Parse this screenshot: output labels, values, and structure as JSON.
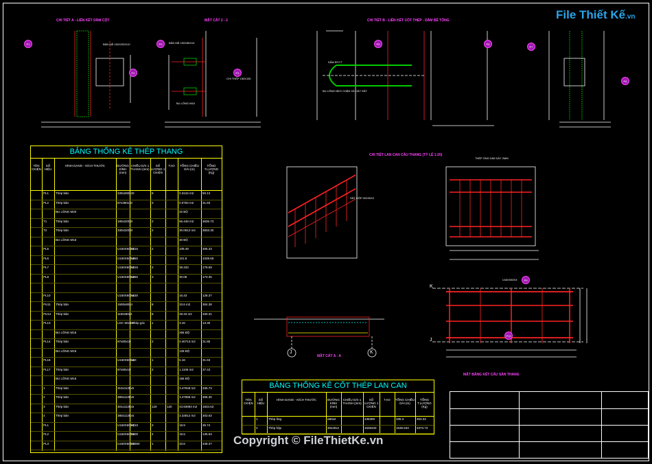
{
  "logo": {
    "brand": "File Thiết Kế",
    "domain": ".vn"
  },
  "copyright": "Copyright © FileThietKe.vn",
  "detail_titles": {
    "d1": "CHI TIẾT A - LIÊN KẾT DẦM CỘT",
    "d2": "MẶT CẮT 2 - 2",
    "d3": "CHI TIẾT B - LIÊN KẾT CỐT THÉP - DẦM BÊ TÔNG",
    "d5": "CHI TIẾT LAN CAN CẦU THANG (TỶ LỆ 1:20)",
    "d7": "MẶT CẮT A - A",
    "d8": "MẶT BẰNG KẾT CẤU SÀN THANG"
  },
  "annotations": {
    "a1": "BẢN MÃ 150X200X10",
    "a2": "BẢN MÃ 150X80X10",
    "a3": "BU LÔNG M16",
    "a4": "CHI THÉP 150X150",
    "a5": "DẦM BTCT",
    "a6": "BU LÔNG NEO CHẬN VÀ DÁY SẮT",
    "a7": "THÉP ỐNG D60 DÀY 2MM",
    "a8": "SẮT HỘP 30X30X2",
    "a9": "U160X60X4"
  },
  "tags": [
    "P1",
    "P2",
    "P3",
    "P4",
    "P5",
    "P6",
    "P7",
    "P8",
    "P9",
    "P10"
  ],
  "axis_marks": [
    "K",
    "J",
    "J",
    "K"
  ],
  "table1": {
    "title": "BẢNG THỐNG KÊ THÉP THANG",
    "headers": [
      "TÊN CKIỆN",
      "SỐ HIỆU",
      "HÌNH DẠNG - KÍCH THƯỚC",
      "ĐƯỜNG KÍNH (mm)",
      "CHIỀU DÀI 1 THANH (mm)",
      "SỐ LƯỢNG 1 CKIỆN",
      "TẠO",
      "TỔNG CHIỀU DÀI (m)",
      "TỔNG T.LƯỢNG (Kg)"
    ],
    "rows": [
      [
        "",
        "PL1",
        "Thép bản",
        "330x280x20",
        "",
        "8",
        "",
        "0.3134 m2",
        "50.13"
      ],
      [
        "",
        "PL2",
        "Thép bản",
        "87x380x10",
        "",
        "3",
        "",
        "0.0784 m2",
        "31.83"
      ],
      [
        "",
        "",
        "BU LÔNG M20",
        "",
        "",
        "",
        "",
        "32 BỘ",
        ""
      ],
      [
        "",
        "T1",
        "Thép bản",
        "180x320x8",
        "",
        "2",
        "",
        "56.448 m2",
        "3635.73"
      ],
      [
        "",
        "T2",
        "Thép bản",
        "330x320x8",
        "",
        "2",
        "",
        "30.0912 m2",
        "3833.30"
      ],
      [
        "",
        "",
        "BU LÔNG M16",
        "",
        "",
        "",
        "",
        "30 BỘ",
        ""
      ],
      [
        "",
        "PL5",
        "",
        "U160X60X4",
        "3315",
        "2",
        "",
        "109.49",
        "305.33"
      ],
      [
        "",
        "PL6",
        "",
        "U160X60X4",
        "1860",
        "",
        "",
        "101.8",
        "1039.59"
      ],
      [
        "",
        "PL7",
        "",
        "U160X60X4",
        "1315",
        "3",
        "",
        "38.333",
        "179.59"
      ],
      [
        "",
        "PL8",
        "",
        "U160X60X4",
        "1360",
        "3",
        "",
        "30.08",
        "173.35"
      ],
      [
        "",
        "",
        "",
        "",
        "",
        "",
        "",
        "",
        ""
      ],
      [
        "",
        "PL10",
        "",
        "U160X60X4",
        "1630",
        "",
        "",
        "16.43",
        "128.37"
      ],
      [
        "",
        "PU11",
        "Thép bản",
        "1500x80x4",
        "",
        "8",
        "",
        "33.6 m2",
        "304.38"
      ],
      [
        "",
        "PU12",
        "Thép bản",
        "1150x80x4",
        "",
        "8",
        "",
        "28.33 m2",
        "330.31"
      ],
      [
        "",
        "PL13",
        "",
        "LGC 50x5 Thép góc",
        "50",
        "1",
        "",
        "3.15",
        "13.30"
      ],
      [
        "",
        "",
        "BU LÔNG M16",
        "",
        "",
        "",
        "",
        "256 BỘ",
        ""
      ],
      [
        "",
        "PL14",
        "Thép bản",
        "87x80x10",
        "",
        "2",
        "",
        "0.40713 m2",
        "31.85"
      ],
      [
        "",
        "",
        "BU LÔNG M16",
        "",
        "",
        "",
        "",
        "128 BỘ",
        ""
      ],
      [
        "",
        "PL16",
        "",
        "U160X60X4",
        "160",
        "1",
        "",
        "5.18",
        "31.63"
      ],
      [
        "",
        "PL17",
        "Thép bản",
        "87x80x10",
        "",
        "2",
        "",
        "1.1106 m2",
        "37.43"
      ],
      [
        "",
        "",
        "BU LÔNG M16",
        "",
        "",
        "",
        "",
        "156 BỘ",
        ""
      ],
      [
        "",
        "1",
        "Thép bản",
        "310x1135x5",
        "",
        "",
        "",
        "3.47948 m2",
        "335.73"
      ],
      [
        "",
        "2",
        "Thép bản",
        "380x1135x5",
        "",
        "",
        "",
        "3.47888 m2",
        "306.30"
      ],
      [
        "",
        "3",
        "Thép bản",
        "301x1135x5",
        "",
        "120",
        "120",
        "43.93984 m2",
        "1834.53"
      ],
      [
        "",
        "4",
        "Thép bản",
        "380x1135x5",
        "",
        "",
        "",
        "3.33812 m2",
        "303.63"
      ],
      [
        "",
        "PL1",
        "",
        "U160X60X4",
        "3310",
        "3",
        "",
        "18.9",
        "35.74"
      ],
      [
        "",
        "PL2",
        "",
        "U160X60X4",
        "3600",
        "4",
        "",
        "15.5",
        "135.63"
      ],
      [
        "",
        "PL3",
        "",
        "U160X60X4",
        "33850",
        "1",
        "",
        "33.8",
        "348.37"
      ]
    ]
  },
  "table2": {
    "title": "BẢNG THỐNG KÊ CỐT THÉP LAN CAN",
    "headers": [
      "TÊN CKIỆN",
      "SỐ HIỆU",
      "HÌNH DẠNG - KÍCH THƯỚC",
      "ĐƯỜNG KÍNH (mm)",
      "CHIỀU DÀI 1 THANH (mm)",
      "SỐ LƯỢNG 1 CKIỆN",
      "TẠO",
      "TỔNG CHIỀU DÀI (m)",
      "TỔNG T.LƯỢNG (Kg)"
    ],
    "rows": [
      [
        "",
        "1",
        "Thép ống",
        "ø60x2",
        "",
        "235300",
        "",
        "335.3",
        "353.34"
      ],
      [
        "",
        "2",
        "Thép hộp",
        "30x30x2",
        "",
        "1535333",
        "",
        "1536.533",
        "3373.73"
      ]
    ]
  }
}
